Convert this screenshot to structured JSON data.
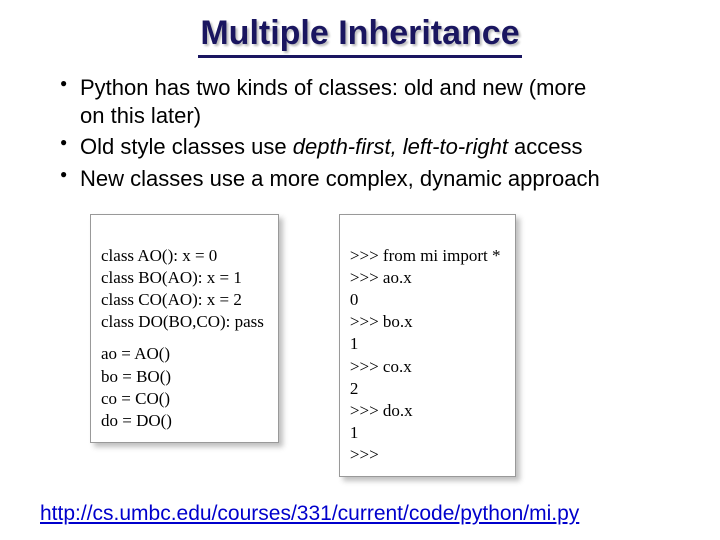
{
  "title": "Multiple Inheritance",
  "bullets": {
    "b1a": "Python has two kinds of classes: old and new (more",
    "b1b": "on this later)",
    "b2a": "Old style classes use ",
    "b2i": "depth-first, left-to-right",
    "b2b": " access",
    "b3": "New classes use a more complex, dynamic approach"
  },
  "code_left": {
    "l1": "class AO(): x = 0",
    "l2": "class BO(AO): x = 1",
    "l3": "class CO(AO): x = 2",
    "l4": "class DO(BO,CO): pass",
    "l5": "ao = AO()",
    "l6": "bo = BO()",
    "l7": "co = CO()",
    "l8": "do = DO()"
  },
  "code_right": {
    "r1": ">>> from mi import *",
    "r2": ">>> ao.x",
    "r3": "0",
    "r4": ">>> bo.x",
    "r5": "1",
    "r6": ">>> co.x",
    "r7": "2",
    "r8": ">>> do.x",
    "r9": "1",
    "r10": ">>>"
  },
  "link": "http://cs.umbc.edu/courses/331/current/code/python/mi.py"
}
